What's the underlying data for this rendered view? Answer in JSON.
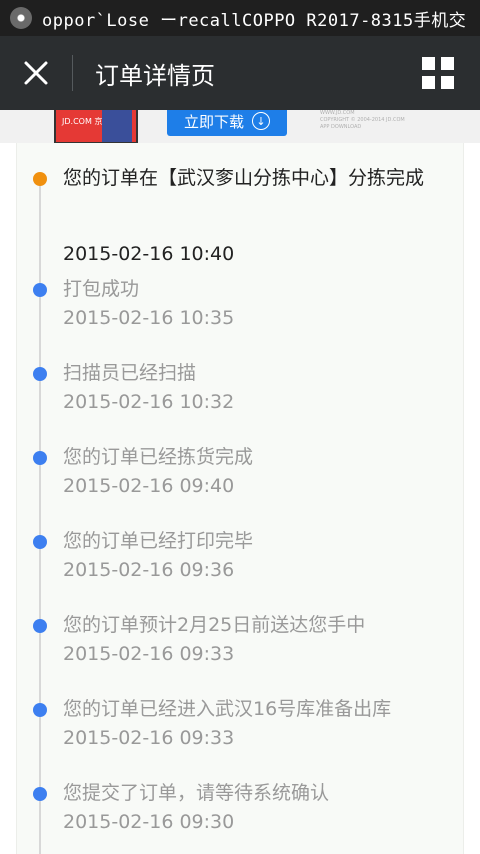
{
  "status_bar": {
    "text": "oppor`Lose ーrecallCOPPO R2017-8315手机交"
  },
  "nav": {
    "title": "订单详情页"
  },
  "banner": {
    "app_label": "JD.COM 京东",
    "download_label": "立即下载",
    "small_text_1": "WWW.JD.COM",
    "small_text_2": "COPYRIGHT © 2004-2014 JD.COM",
    "small_text_3": "APP DOWNLOAD"
  },
  "timeline": [
    {
      "text": "您的订单在【武汉奓山分拣中心】分拣完成",
      "time": "2015-02-16 10:40",
      "current": true
    },
    {
      "text": "打包成功",
      "time": "2015-02-16 10:35",
      "current": false
    },
    {
      "text": "扫描员已经扫描",
      "time": "2015-02-16 10:32",
      "current": false
    },
    {
      "text": "您的订单已经拣货完成",
      "time": "2015-02-16 09:40",
      "current": false
    },
    {
      "text": "您的订单已经打印完毕",
      "time": "2015-02-16 09:36",
      "current": false
    },
    {
      "text": "您的订单预计2月25日前送达您手中",
      "time": "2015-02-16 09:33",
      "current": false
    },
    {
      "text": "您的订单已经进入武汉16号库准备出库",
      "time": "2015-02-16 09:33",
      "current": false
    },
    {
      "text": "您提交了订单，请等待系统确认",
      "time": "2015-02-16 09:30",
      "current": false
    }
  ],
  "colors": {
    "current_dot": "#f0900f",
    "past_dot": "#3d7ff0",
    "nav_bg": "#2b2e30"
  }
}
